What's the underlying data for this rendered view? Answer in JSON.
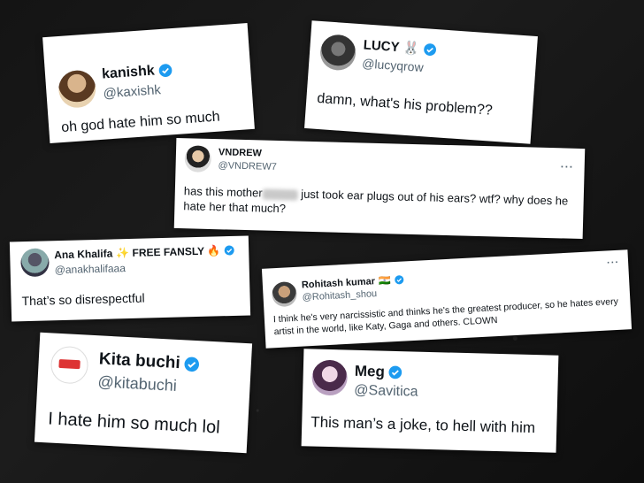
{
  "tweets": [
    {
      "name": "kanishk",
      "handle": "@kaxishk",
      "text": "oh god hate him so much",
      "verified": true,
      "avatar": "portrait-avatar"
    },
    {
      "name": "LUCY",
      "name_emoji": "🐰",
      "handle": "@lucyqrow",
      "text": "damn, what's his problem??",
      "verified": true,
      "avatar": "character-avatar"
    },
    {
      "name": "VNDREW",
      "handle": "@VNDREW7",
      "text_before": "has this mother",
      "text_after": " just took ear plugs out of his ears? wtf? why does he hate her that much?",
      "verified": false,
      "more": "···",
      "avatar": "cap-avatar"
    },
    {
      "name": "Ana Khalifa",
      "name_extra": "✨ FREE FANSLY 🔥",
      "handle": "@anakhalifaaa",
      "text": "That’s so disrespectful",
      "verified": true,
      "avatar": "photo-avatar"
    },
    {
      "name": "Rohitash kumar",
      "name_emoji": "🇮🇳",
      "handle": "@Rohitash_shou",
      "text": "I think he's very narcissistic and thinks he's the greatest producer, so he hates every artist in the world, like Katy, Gaga and others. CLOWN",
      "verified": true,
      "more": "···",
      "avatar": "portrait-avatar"
    },
    {
      "name": "Kita buchi",
      "handle": "@kitabuchi",
      "text": "I hate him so much lol",
      "verified": true,
      "avatar": "logo-avatar"
    },
    {
      "name": "Meg",
      "handle": "@Savitica",
      "text": "This man’s a joke, to hell with him",
      "verified": true,
      "avatar": "anime-avatar"
    }
  ],
  "colors": {
    "verified": "#1d9bf0",
    "handle": "#536471"
  }
}
